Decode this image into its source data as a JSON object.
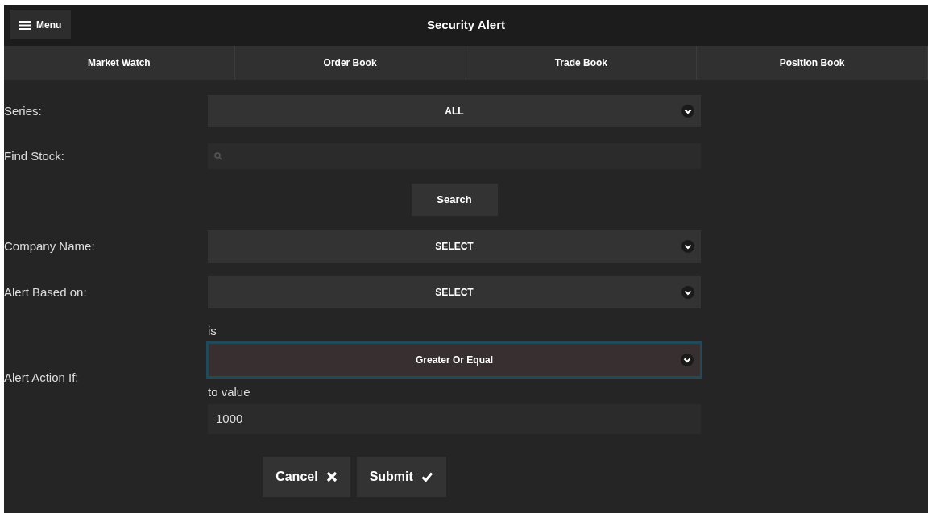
{
  "header": {
    "menu_button": "Menu",
    "title": "Security Alert"
  },
  "tabs": [
    "Market Watch",
    "Order Book",
    "Trade Book",
    "Position Book"
  ],
  "form": [
    {
      "kind": "select",
      "label": "Series:",
      "value": "ALL"
    },
    {
      "kind": "search",
      "label": "Find Stock:"
    },
    {
      "kind": "button",
      "button": "Search"
    },
    {
      "kind": "select",
      "label": "Company Name:",
      "value": "SELECT"
    },
    {
      "kind": "select",
      "label": "Alert Based on:",
      "value": "SELECT"
    },
    {
      "kind": "condition",
      "label": "Alert Action If:",
      "operator_caption": "is",
      "operator": "Greater Or Equal",
      "focused": true,
      "value_caption": "to value",
      "value": "1000"
    }
  ],
  "actions": [
    {
      "kind": "cancel",
      "label": "Cancel"
    },
    {
      "kind": "submit",
      "label": "Submit"
    }
  ]
}
